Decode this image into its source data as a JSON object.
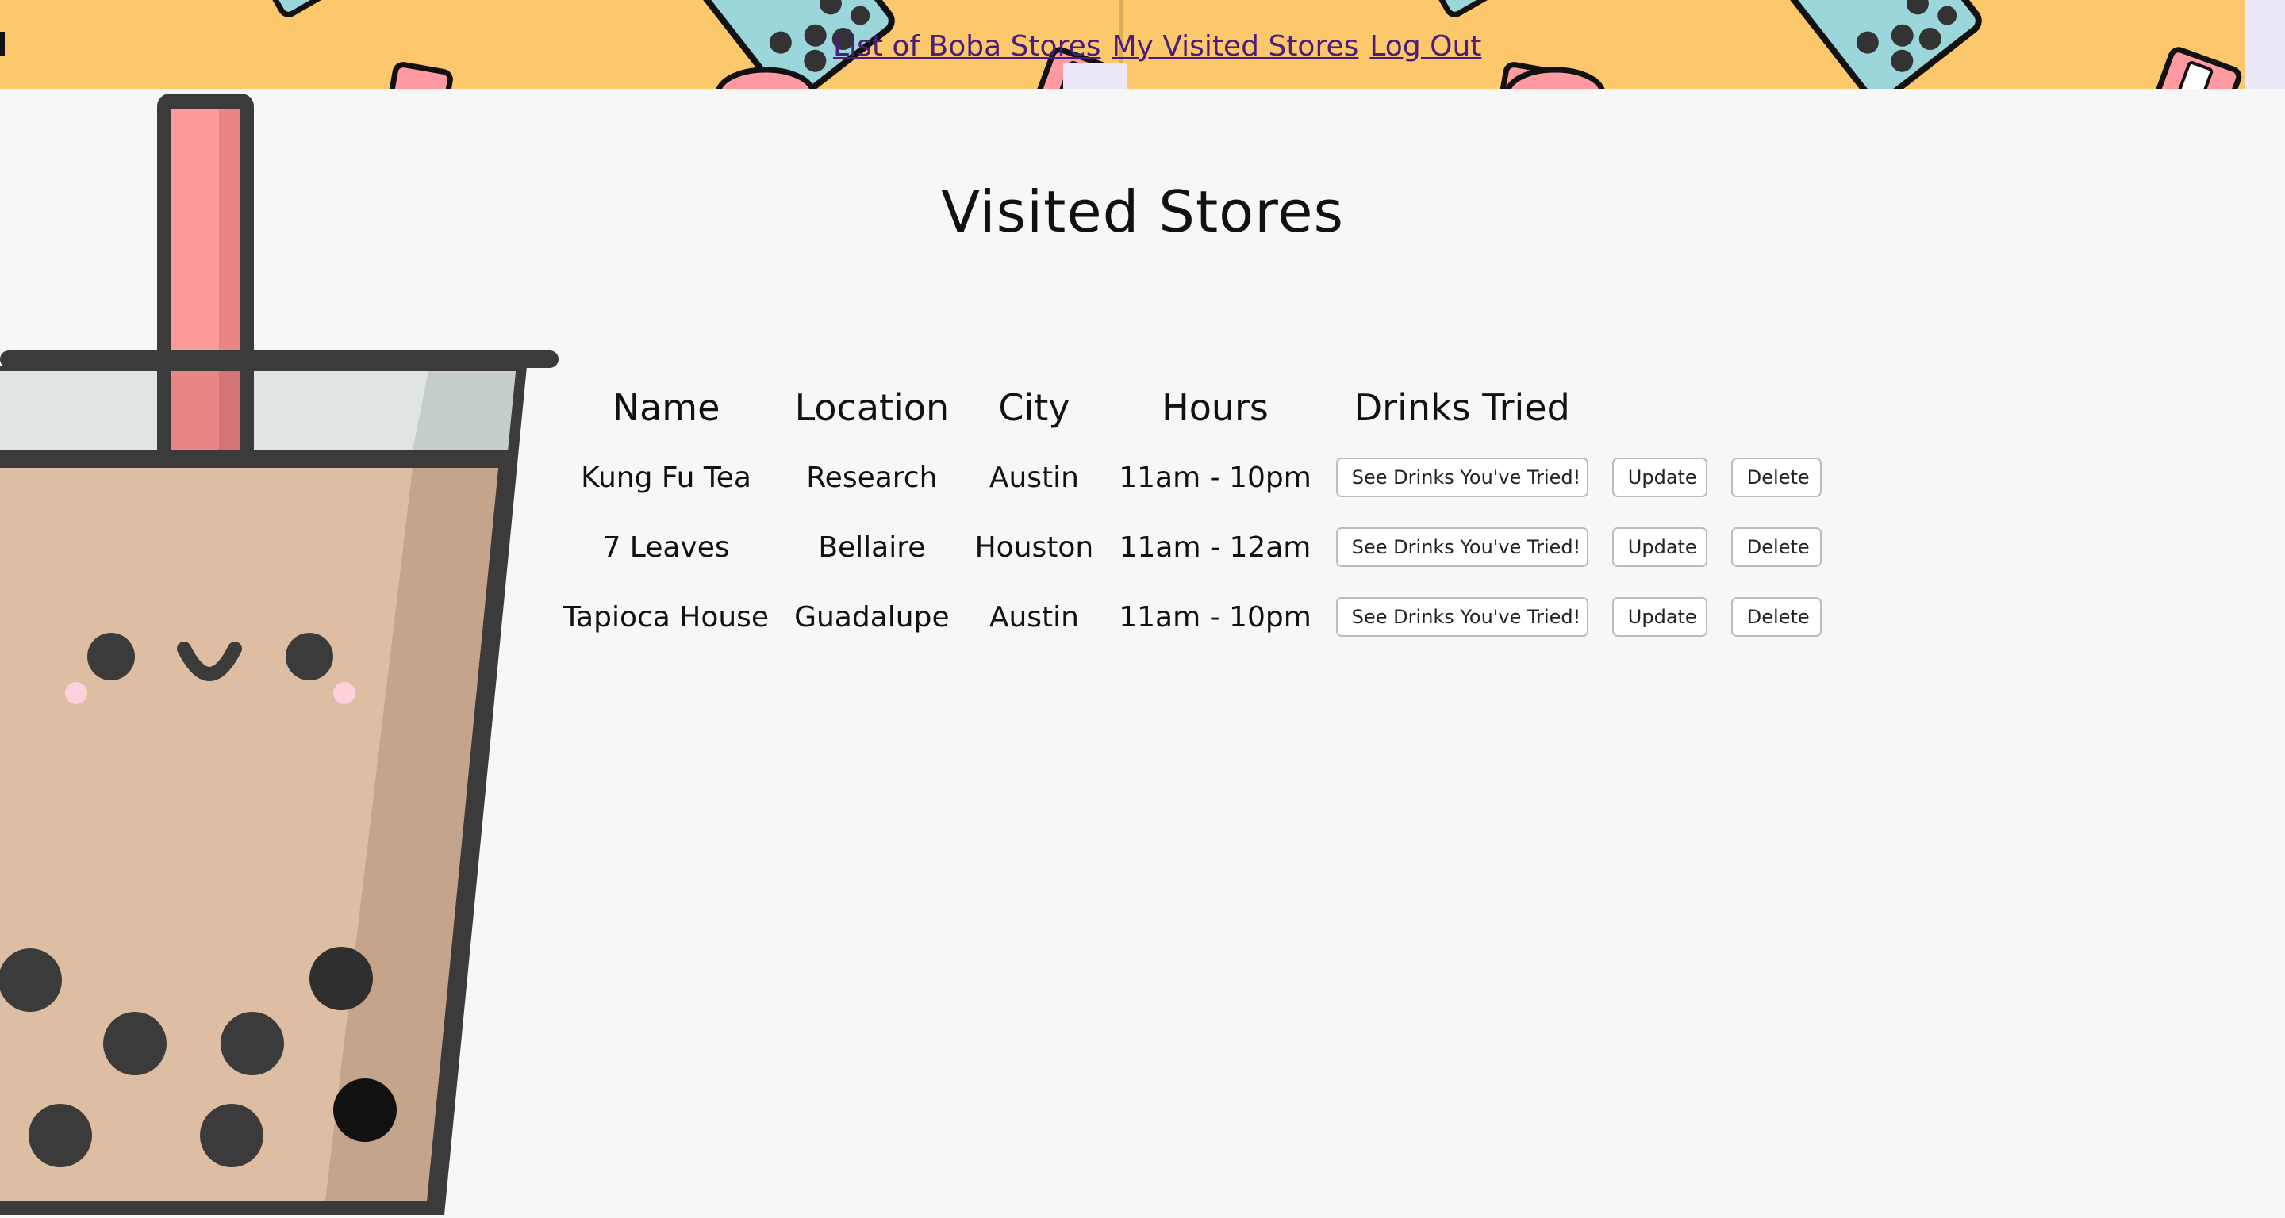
{
  "nav": {
    "links": [
      {
        "label": "List of Boba Stores"
      },
      {
        "label": "My Visited Stores"
      },
      {
        "label": "Log Out"
      }
    ]
  },
  "page": {
    "title": "Visited Stores"
  },
  "table": {
    "headers": [
      "Name",
      "Location",
      "City",
      "Hours",
      "Drinks Tried"
    ],
    "rows": [
      {
        "name": "Kung Fu Tea",
        "location": "Research",
        "city": "Austin",
        "hours": "11am - 10pm"
      },
      {
        "name": "7 Leaves",
        "location": "Bellaire",
        "city": "Houston",
        "hours": "11am - 12am"
      },
      {
        "name": "Tapioca House",
        "location": "Guadalupe",
        "city": "Austin",
        "hours": "11am - 10pm"
      }
    ],
    "buttons": {
      "see_drinks": "See Drinks You've Tried!",
      "update": "Update",
      "delete": "Delete"
    }
  },
  "colors": {
    "banner": "#fdc86c",
    "background": "#f7f7f7",
    "link": "#4a1f7a",
    "tea": "#ddbea2",
    "cup_outline": "#3b3b3b",
    "straw": "#ff9a9a"
  }
}
